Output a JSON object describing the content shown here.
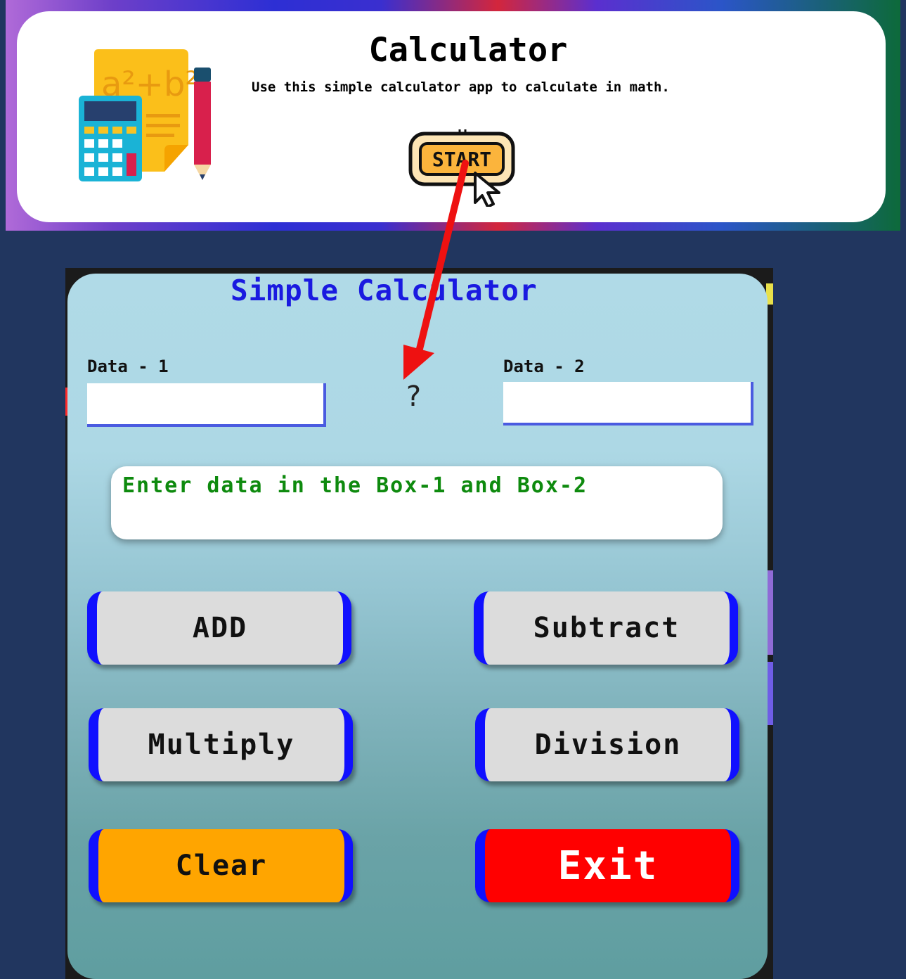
{
  "banner": {
    "title": "Calculator",
    "subtitle": "Use this simple calculator app to calculate in math.",
    "start_label": "START",
    "logo_text": "a²+b²"
  },
  "calculator": {
    "title": "Simple Calculator",
    "data1_label": "Data - 1",
    "data1_value": "",
    "data2_label": "Data - 2",
    "data2_value": "",
    "operator": "?",
    "message": "Enter data in the Box-1 and Box-2",
    "buttons": {
      "add": "ADD",
      "subtract": "Subtract",
      "multiply": "Multiply",
      "division": "Division",
      "clear": "Clear",
      "exit": "Exit"
    }
  },
  "colors": {
    "page_bg": "#21365f",
    "panel_top": "#add8e6",
    "panel_bottom": "#5f9ea0",
    "title_blue": "#1a1ae0",
    "message_green": "#0e8a0e",
    "button_border": "#1010ff",
    "clear_button": "#ffa500",
    "exit_button": "#ff0000",
    "arrow": "#ee1111"
  }
}
